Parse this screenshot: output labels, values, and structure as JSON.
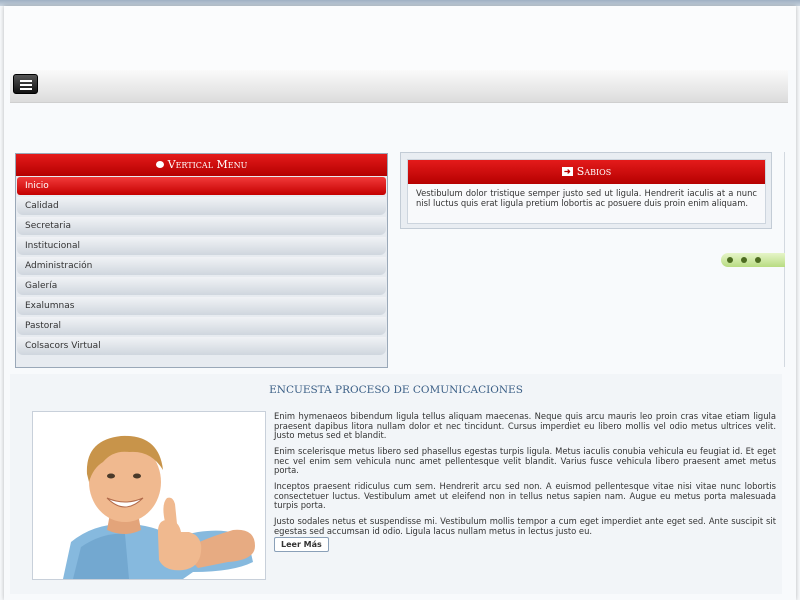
{
  "vertical_menu": {
    "title": "Vertical Menu",
    "items": [
      {
        "label": "Inicio"
      },
      {
        "label": "Calidad"
      },
      {
        "label": "Secretaria"
      },
      {
        "label": "Institucional"
      },
      {
        "label": "Administración"
      },
      {
        "label": "Galería"
      },
      {
        "label": "Exalumnas"
      },
      {
        "label": "Pastoral"
      },
      {
        "label": "Colsacors Virtual"
      }
    ]
  },
  "sabios": {
    "title": "Sabios",
    "icon": "arrow-right-icon",
    "text": "Vestibulum dolor tristique semper justo sed ut ligula. Hendrerit iaculis at a nunc nisl luctus quis erat ligula pretium lobortis ac posuere duis proin enim aliquam."
  },
  "article": {
    "title": "ENCUESTA PROCESO DE COMUNICACIONES",
    "paragraphs": [
      "Enim hymenaeos bibendum ligula tellus aliquam maecenas. Neque quis arcu mauris leo proin cras vitae etiam ligula praesent dapibus litora nullam dolor et nec tincidunt. Cursus imperdiet eu libero mollis vel odio metus ultrices velit. Justo metus sed et blandit.",
      "Enim scelerisque metus libero sed phasellus egestas turpis ligula. Metus iaculis conubia vehicula eu feugiat id. Et eget nec vel enim sem vehicula nunc amet pellentesque velit blandit. Varius fusce vehicula libero praesent amet metus porta.",
      "Inceptos praesent ridiculus cum sem. Hendrerit arcu sed non. A euismod pellentesque vitae nisi vitae nunc lobortis consectetuer luctus. Vestibulum amet ut eleifend non in tellus netus sapien nam. Augue eu metus porta malesuada turpis porta.",
      "Justo sodales netus et suspendisse mi. Vestibulum mollis tempor a cum eget imperdiet ante eget sed. Ante suscipit sit egestas sed accumsan id odio. Ligula lacus nullam metus in lectus justo eu."
    ],
    "read_more": "Leer Más"
  },
  "colors": {
    "accent_red": "#c40000",
    "title_blue": "#3b5f86",
    "slider_green": "#b8dc82"
  }
}
